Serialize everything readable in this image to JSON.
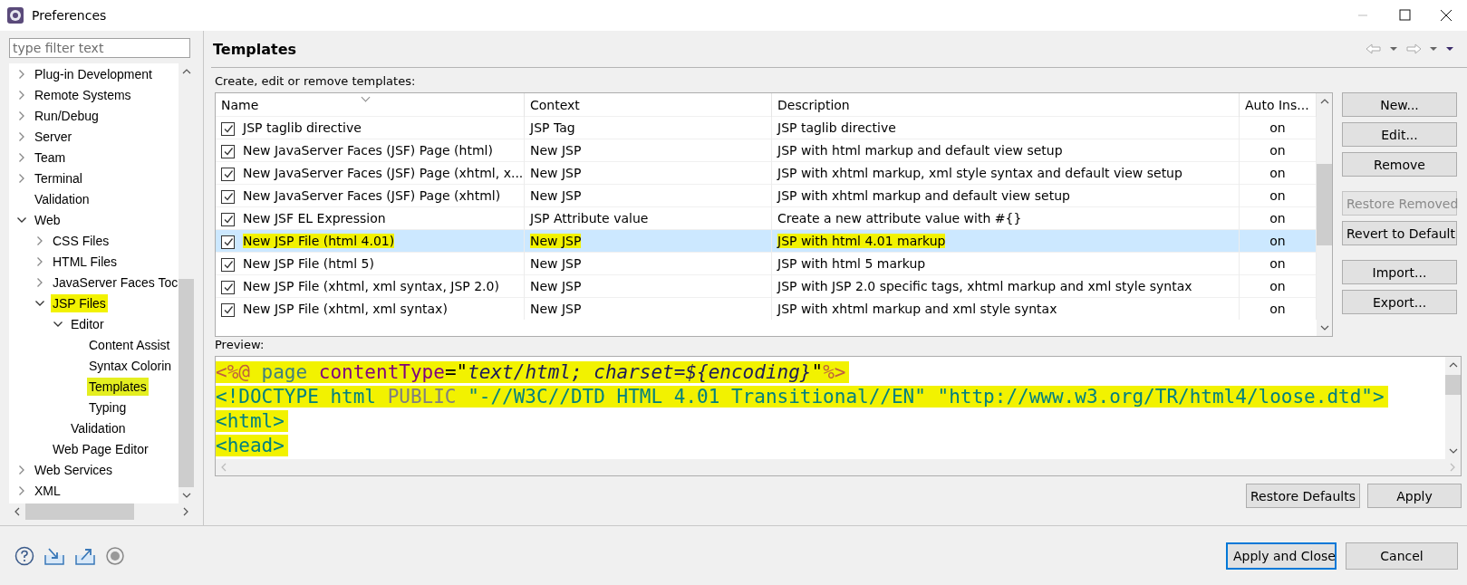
{
  "window": {
    "title": "Preferences"
  },
  "filter": {
    "placeholder": "type filter text"
  },
  "tree": [
    {
      "label": "Plug-in Development",
      "expanded": false
    },
    {
      "label": "Remote Systems",
      "expanded": false
    },
    {
      "label": "Run/Debug",
      "expanded": false
    },
    {
      "label": "Server",
      "expanded": false
    },
    {
      "label": "Team",
      "expanded": false
    },
    {
      "label": "Terminal",
      "expanded": false
    },
    {
      "label": "Validation"
    },
    {
      "label": "Web",
      "expanded": true,
      "children": [
        {
          "label": "CSS Files",
          "expanded": false
        },
        {
          "label": "HTML Files",
          "expanded": false
        },
        {
          "label": "JavaServer Faces Toc",
          "expanded": false
        },
        {
          "label": "JSP Files",
          "expanded": true,
          "highlighted": true,
          "children": [
            {
              "label": "Editor",
              "expanded": true,
              "children": [
                {
                  "label": "Content Assist"
                },
                {
                  "label": "Syntax Colorin"
                },
                {
                  "label": "Templates",
                  "selected": true,
                  "highlighted": true
                },
                {
                  "label": "Typing"
                }
              ]
            },
            {
              "label": "Validation"
            }
          ]
        },
        {
          "label": "Web Page Editor"
        }
      ]
    },
    {
      "label": "Web Services",
      "expanded": false
    },
    {
      "label": "XML",
      "expanded": false
    }
  ],
  "page": {
    "title": "Templates",
    "description": "Create, edit or remove templates:"
  },
  "templates": {
    "columns": [
      "Name",
      "Context",
      "Description",
      "Auto Ins..."
    ],
    "rows": [
      {
        "checked": true,
        "selected": false,
        "highlighted": false,
        "name": "JSP taglib directive",
        "context": "JSP Tag",
        "description": "JSP taglib directive",
        "auto_insert": "on"
      },
      {
        "checked": true,
        "selected": false,
        "highlighted": false,
        "name": "New JavaServer Faces (JSF) Page (html)",
        "context": "New JSP",
        "description": "JSP with html markup and default view setup",
        "auto_insert": "on"
      },
      {
        "checked": true,
        "selected": false,
        "highlighted": false,
        "name": "New JavaServer Faces (JSF) Page (xhtml, x...",
        "context": "New JSP",
        "description": "JSP with xhtml markup, xml style syntax and default view setup",
        "auto_insert": "on"
      },
      {
        "checked": true,
        "selected": false,
        "highlighted": false,
        "name": "New JavaServer Faces (JSF) Page (xhtml)",
        "context": "New JSP",
        "description": "JSP with xhtml markup and default view setup",
        "auto_insert": "on"
      },
      {
        "checked": true,
        "selected": false,
        "highlighted": false,
        "name": "New JSF EL Expression",
        "context": "JSP Attribute value",
        "description": "Create a new attribute value with #{}",
        "auto_insert": "on"
      },
      {
        "checked": true,
        "selected": true,
        "highlighted": true,
        "name": "New JSP File (html 4.01)",
        "context": "New JSP",
        "description": "JSP with html 4.01 markup",
        "auto_insert": "on"
      },
      {
        "checked": true,
        "selected": false,
        "highlighted": false,
        "name": "New JSP File (html 5)",
        "context": "New JSP",
        "description": "JSP with html 5 markup",
        "auto_insert": "on"
      },
      {
        "checked": true,
        "selected": false,
        "highlighted": false,
        "name": "New JSP File (xhtml, xml syntax, JSP 2.0)",
        "context": "New JSP",
        "description": "JSP with JSP 2.0 specific tags, xhtml markup and xml style syntax",
        "auto_insert": "on"
      },
      {
        "checked": true,
        "selected": false,
        "highlighted": false,
        "name": "New JSP File (xhtml, xml syntax)",
        "context": "New JSP",
        "description": "JSP with xhtml markup and xml style syntax",
        "auto_insert": "on"
      }
    ]
  },
  "side_buttons": [
    {
      "label": "New...",
      "disabled": false
    },
    {
      "label": "Edit...",
      "disabled": false
    },
    {
      "label": "Remove",
      "disabled": false
    },
    {
      "label": "Restore Removed",
      "disabled": true
    },
    {
      "label": "Revert to Default",
      "disabled": false
    },
    {
      "label": "Import...",
      "disabled": false
    },
    {
      "label": "Export...",
      "disabled": false
    }
  ],
  "preview": {
    "label": "Preview:",
    "lines": [
      {
        "highlighted": true,
        "tokens": [
          {
            "kind": "delim",
            "text": "<%@ "
          },
          {
            "kind": "tag",
            "text": "page "
          },
          {
            "kind": "attr",
            "text": "contentType"
          },
          {
            "kind": "plain",
            "text": "=\""
          },
          {
            "kind": "value",
            "text": "text/html; charset=${encoding}"
          },
          {
            "kind": "plain",
            "text": "\""
          },
          {
            "kind": "delim",
            "text": "%>"
          }
        ]
      },
      {
        "highlighted": true,
        "tokens": [
          {
            "kind": "doctype",
            "text": "<!DOCTYPE html "
          },
          {
            "kind": "keyword",
            "text": "PUBLIC"
          },
          {
            "kind": "doctype",
            "text": " \"-//W3C//DTD HTML 4.01 Transitional//EN\" \"http://www.w3.org/TR/html4/loose.dtd\">"
          }
        ]
      },
      {
        "highlighted": true,
        "tokens": [
          {
            "kind": "doctype",
            "text": "<html>"
          }
        ]
      },
      {
        "highlighted": true,
        "tokens": [
          {
            "kind": "doctype",
            "text": "<head>"
          }
        ]
      }
    ]
  },
  "page_buttons": [
    "Restore Defaults",
    "Apply"
  ],
  "dialog_buttons": [
    {
      "label": "Apply and Close",
      "default": true
    },
    {
      "label": "Cancel",
      "default": false
    }
  ]
}
